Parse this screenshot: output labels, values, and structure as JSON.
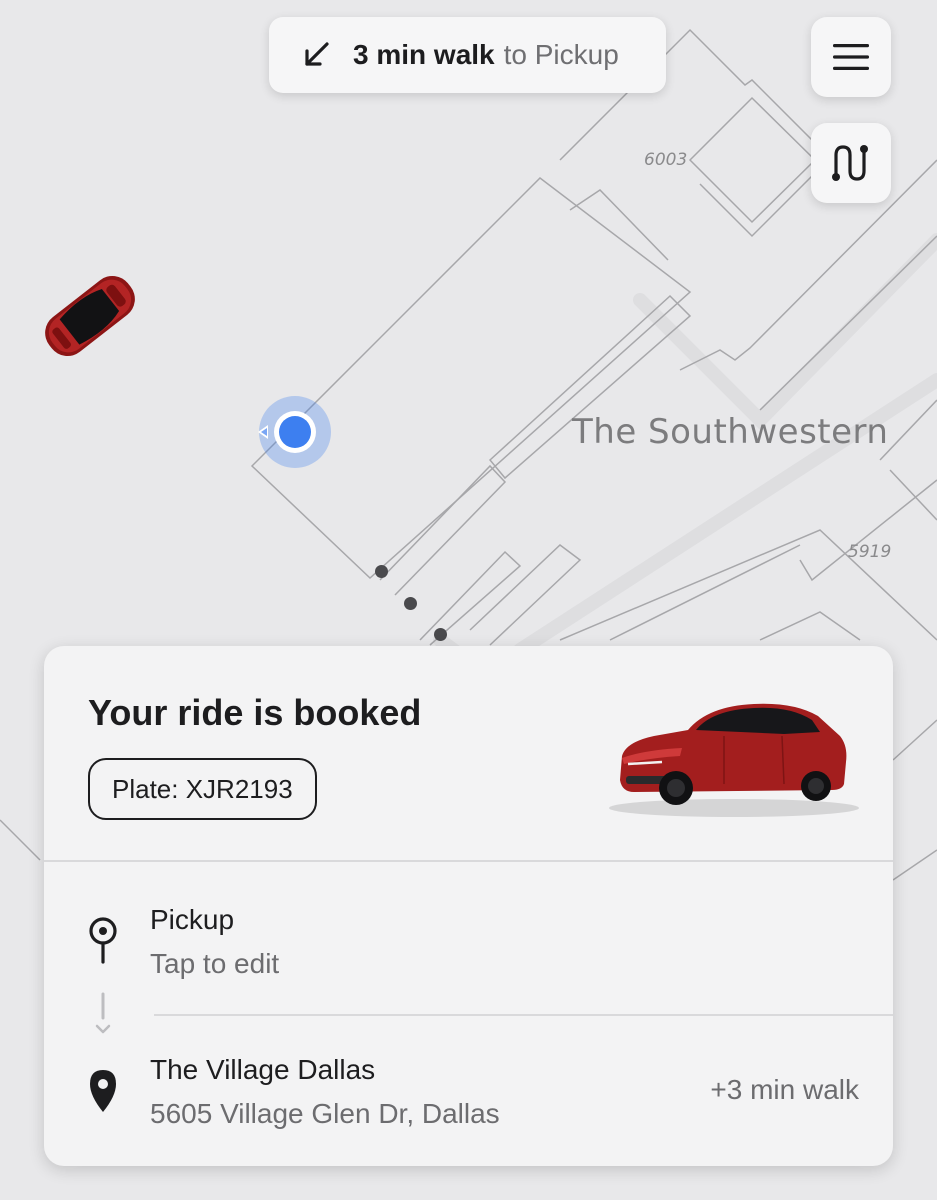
{
  "walk_banner": {
    "icon": "arrow-down-left-icon",
    "duration": "3 min walk",
    "destination": "to Pickup"
  },
  "map": {
    "place_label": "The Southwestern",
    "building_numbers": [
      "6003",
      "5919"
    ]
  },
  "controls": {
    "menu_icon": "hamburger-menu-icon",
    "route_icon": "route-icon"
  },
  "ride": {
    "title": "Your ride is booked",
    "plate": "Plate: XJR2193",
    "car_color": "#a31e1e"
  },
  "pickup": {
    "icon": "pickup-pin-icon",
    "title": "Pickup",
    "subtitle": "Tap to edit"
  },
  "destination": {
    "icon": "location-pin-icon",
    "title": "The Village Dallas",
    "address": "5605 Village Glen Dr, Dallas",
    "extra": "+3 min walk"
  },
  "colors": {
    "accent_blue": "#3d7ff0",
    "text_primary": "#1d1d1f",
    "text_secondary": "#6c6c6f"
  }
}
